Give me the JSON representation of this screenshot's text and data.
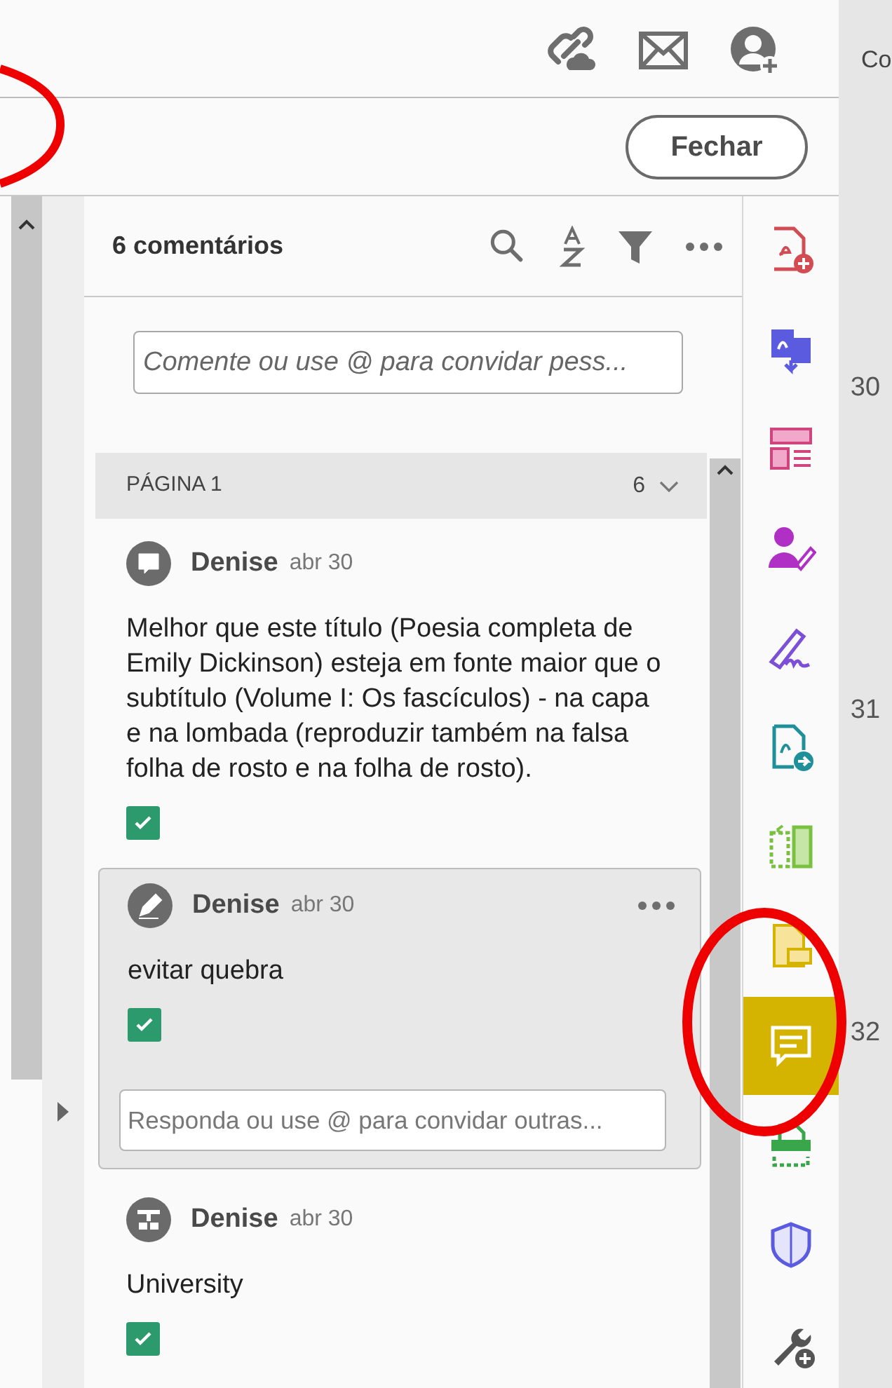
{
  "top_toolbar": {
    "icons": [
      {
        "kind": "link-cloud"
      },
      {
        "kind": "mail"
      },
      {
        "kind": "user-add"
      }
    ],
    "side_label": "Co"
  },
  "close_button": {
    "label": "Fechar"
  },
  "comments_panel": {
    "title": "6 comentários",
    "tools": [
      {
        "kind": "search"
      },
      {
        "kind": "sort"
      },
      {
        "kind": "filter"
      },
      {
        "kind": "more"
      }
    ],
    "comment_field": {
      "placeholder": "Comente ou use @ para convidar pess..."
    },
    "page_group": {
      "label": "PÁGINA 1",
      "count": "6",
      "expanded": true
    },
    "comments": [
      {
        "kind": "note",
        "author": "Denise",
        "date": "abr 30",
        "text": "Melhor que este título (Poesia completa de Emily Dickinson) esteja em fonte maior que o subtítulo (Volume I: Os fascículos) - na capa e na lombada (reproduzir também na falsa folha de rosto e na folha de rosto).",
        "checked": true,
        "selected": false
      },
      {
        "kind": "pen",
        "author": "Denise",
        "date": "abr 30",
        "text": "evitar quebra",
        "checked": true,
        "selected": true,
        "reply_placeholder": "Responda ou use @ para convidar outras..."
      },
      {
        "kind": "text-edit",
        "author": "Denise",
        "date": "abr 30",
        "text": "University",
        "checked": true,
        "selected": false
      }
    ]
  },
  "tool_rail": [
    {
      "kind": "pdf-add",
      "selected": false
    },
    {
      "kind": "convert",
      "selected": false
    },
    {
      "kind": "layout",
      "selected": false
    },
    {
      "kind": "user-pen",
      "selected": false
    },
    {
      "kind": "sign",
      "selected": false
    },
    {
      "kind": "pdf-export",
      "selected": false
    },
    {
      "kind": "compare",
      "selected": false
    },
    {
      "kind": "note-file",
      "selected": false
    },
    {
      "kind": "comment",
      "selected": true
    },
    {
      "kind": "scan",
      "selected": false
    },
    {
      "kind": "shield",
      "selected": false
    },
    {
      "kind": "wrench-add",
      "selected": false
    }
  ],
  "page_numbers": [
    "30",
    "31",
    "32"
  ]
}
